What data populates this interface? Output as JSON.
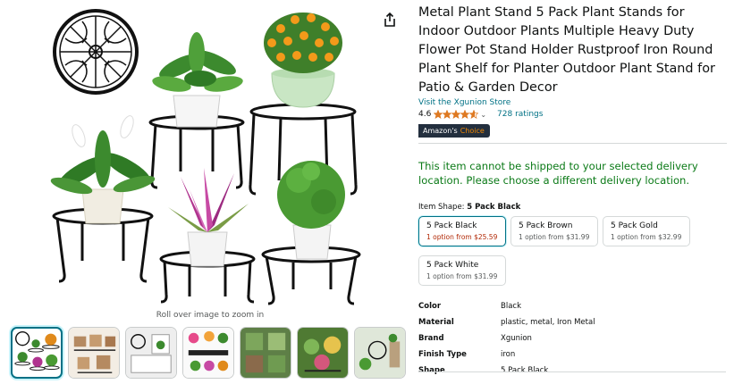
{
  "product": {
    "title": "Metal Plant Stand 5 Pack Plant Stands for Indoor Outdoor Plants Multiple Heavy Duty Flower Pot Stand Holder Rustproof Iron Round Plant Shelf for Planter Outdoor Plant Stand for Patio & Garden Decor",
    "store_link": "Visit the Xgunion Store",
    "rating_value": "4.6",
    "stars_filled": 4.6,
    "rating_chevron": "⌄",
    "ratings_count": "728 ratings",
    "badge_prefix": "Amazon's",
    "badge_suffix": "Choice"
  },
  "image": {
    "zoom_hint": "Roll over image to zoom in",
    "thumbnail_count": 7,
    "selected_thumbnail": 0
  },
  "icons": {
    "share": "share-icon",
    "star": "star-icon",
    "chevron": "chevron-down-icon"
  },
  "delivery": {
    "message": "This item cannot be shipped to your selected delivery location. Please choose a different delivery location."
  },
  "variation": {
    "label": "Item Shape:",
    "selected": "5 Pack Black",
    "options": [
      {
        "name": "5 Pack Black",
        "price": "1 option from $25.59",
        "selected": true
      },
      {
        "name": "5 Pack Brown",
        "price": "1 option from $31.99",
        "selected": false
      },
      {
        "name": "5 Pack Gold",
        "price": "1 option from $32.99",
        "selected": false
      },
      {
        "name": "5 Pack White",
        "price": "1 option from $31.99",
        "selected": false
      }
    ]
  },
  "specs": [
    {
      "key": "Color",
      "value": "Black"
    },
    {
      "key": "Material",
      "value": "plastic, metal, Iron Metal"
    },
    {
      "key": "Brand",
      "value": "Xgunion"
    },
    {
      "key": "Finish Type",
      "value": "iron"
    },
    {
      "key": "Shape",
      "value": "5 Pack Black"
    }
  ],
  "colors": {
    "link": "#007185",
    "delivery_green": "#0b7a17",
    "price_red": "#b12704",
    "star_orange": "#de7921",
    "badge_bg": "#232f3e",
    "badge_orange": "#f08804"
  }
}
